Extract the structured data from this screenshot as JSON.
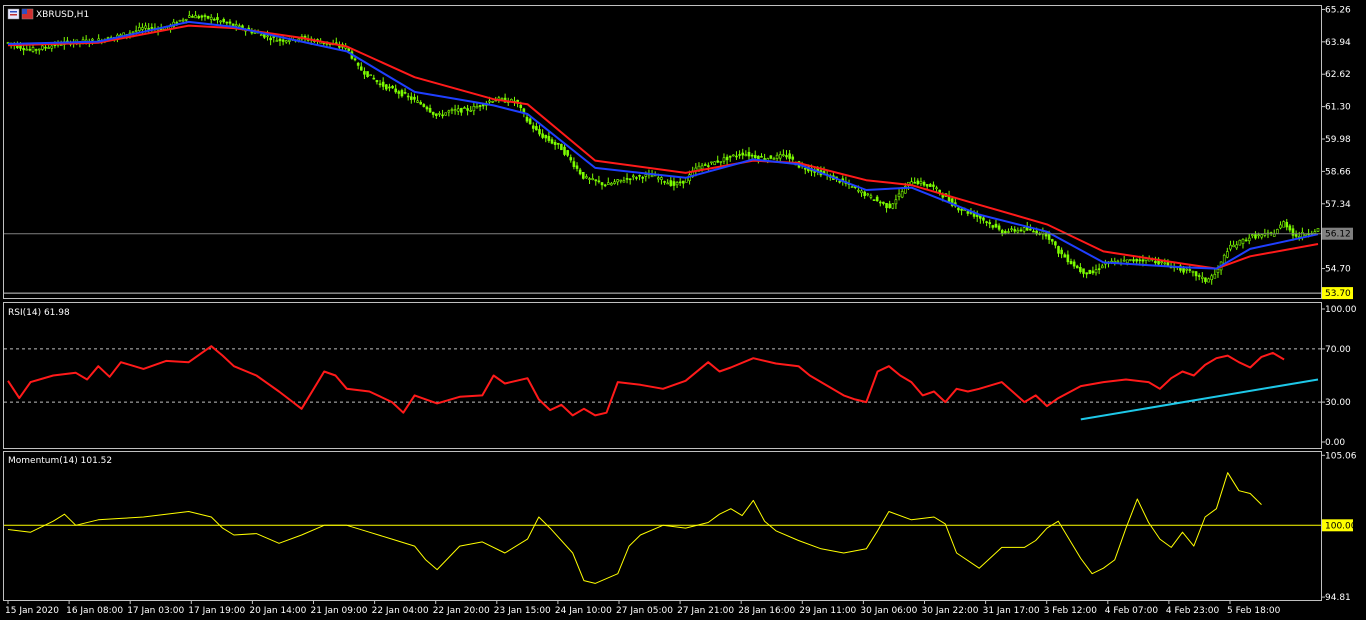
{
  "symbol_label": "XBRUSD,H1",
  "colors": {
    "background": "#000000",
    "frame": "#c0c0c0",
    "text": "#ffffff",
    "candle": "#7cfc00",
    "ma_fast": "#1f3fff",
    "ma_slow": "#ff1a1a",
    "rsi_line": "#ff1a1a",
    "trendline": "#1ec8e8",
    "momentum_line": "#ffff00",
    "level_hline": "#ffff00",
    "last_price_bg": "#808080",
    "low_price_bg": "#ffff00"
  },
  "chart_data": [
    {
      "type": "candlestick",
      "name": "price",
      "y_ticks": [
        "65.26",
        "63.94",
        "62.62",
        "61.30",
        "59.98",
        "58.66",
        "57.34",
        "56.12",
        "54.70"
      ],
      "ylim": [
        53.5,
        65.4
      ],
      "last_price": 56.12,
      "last_price_label": "56.12",
      "low_line": 53.7,
      "low_line_label": "53.70",
      "x_labels": [
        "15 Jan 2020",
        "16 Jan 08:00",
        "17 Jan 03:00",
        "17 Jan 19:00",
        "20 Jan 14:00",
        "21 Jan 09:00",
        "22 Jan 04:00",
        "22 Jan 20:00",
        "23 Jan 15:00",
        "24 Jan 10:00",
        "27 Jan 05:00",
        "27 Jan 21:00",
        "28 Jan 16:00",
        "29 Jan 11:00",
        "30 Jan 06:00",
        "30 Jan 22:00",
        "31 Jan 17:00",
        "3 Feb 12:00",
        "4 Feb 07:00",
        "4 Feb 23:00",
        "5 Feb 18:00"
      ],
      "close_path": [
        [
          0,
          63.9
        ],
        [
          2,
          63.6
        ],
        [
          5,
          63.9
        ],
        [
          8,
          64.0
        ],
        [
          10,
          64.2
        ],
        [
          12,
          64.5
        ],
        [
          14,
          64.5
        ],
        [
          16,
          65.0
        ],
        [
          18,
          64.9
        ],
        [
          20,
          64.6
        ],
        [
          22,
          64.3
        ],
        [
          24,
          64.0
        ],
        [
          26,
          64.1
        ],
        [
          28,
          63.9
        ],
        [
          30,
          63.7
        ],
        [
          31,
          62.9
        ],
        [
          33,
          62.2
        ],
        [
          35,
          61.8
        ],
        [
          37,
          61.3
        ],
        [
          38,
          60.9
        ],
        [
          39,
          61.1
        ],
        [
          41,
          61.2
        ],
        [
          43,
          61.6
        ],
        [
          45,
          61.5
        ],
        [
          46,
          60.7
        ],
        [
          47,
          60.2
        ],
        [
          49,
          59.6
        ],
        [
          51,
          58.4
        ],
        [
          53,
          58.1
        ],
        [
          55,
          58.4
        ],
        [
          57,
          58.5
        ],
        [
          59,
          58.1
        ],
        [
          60,
          58.3
        ],
        [
          61,
          58.8
        ],
        [
          63,
          59.1
        ],
        [
          65,
          59.4
        ],
        [
          67,
          59.2
        ],
        [
          69,
          59.3
        ],
        [
          70,
          58.9
        ],
        [
          72,
          58.6
        ],
        [
          74,
          58.2
        ],
        [
          76,
          57.7
        ],
        [
          78,
          57.2
        ],
        [
          80,
          58.3
        ],
        [
          82,
          58.0
        ],
        [
          84,
          57.2
        ],
        [
          86,
          56.8
        ],
        [
          88,
          56.2
        ],
        [
          90,
          56.3
        ],
        [
          92,
          56.1
        ],
        [
          93,
          55.4
        ],
        [
          95,
          54.6
        ],
        [
          96,
          54.5
        ],
        [
          97,
          54.9
        ],
        [
          99,
          55.0
        ],
        [
          101,
          55.1
        ],
        [
          103,
          54.8
        ],
        [
          105,
          54.5
        ],
        [
          106,
          54.2
        ],
        [
          107,
          54.5
        ],
        [
          108,
          55.5
        ],
        [
          110,
          56.0
        ],
        [
          112,
          56.1
        ],
        [
          113,
          56.6
        ],
        [
          114,
          56.0
        ],
        [
          116,
          56.3
        ]
      ],
      "series": [
        {
          "name": "",
          "kind": "ma_fast",
          "values": [
            [
              0,
              63.85
            ],
            [
              8,
              63.95
            ],
            [
              16,
              64.75
            ],
            [
              20,
              64.55
            ],
            [
              26,
              63.95
            ],
            [
              30,
              63.55
            ],
            [
              36,
              61.9
            ],
            [
              43,
              61.35
            ],
            [
              46,
              61.0
            ],
            [
              52,
              58.8
            ],
            [
              60,
              58.4
            ],
            [
              66,
              59.15
            ],
            [
              70,
              58.95
            ],
            [
              76,
              57.9
            ],
            [
              80,
              58.0
            ],
            [
              86,
              56.9
            ],
            [
              92,
              56.2
            ],
            [
              97,
              54.95
            ],
            [
              104,
              54.75
            ],
            [
              107,
              54.7
            ],
            [
              110,
              55.5
            ],
            [
              116,
              56.1
            ]
          ]
        },
        {
          "name": "",
          "kind": "ma_slow",
          "values": [
            [
              0,
              63.8
            ],
            [
              8,
              63.9
            ],
            [
              16,
              64.6
            ],
            [
              20,
              64.5
            ],
            [
              26,
              64.1
            ],
            [
              30,
              63.75
            ],
            [
              36,
              62.5
            ],
            [
              43,
              61.6
            ],
            [
              46,
              61.4
            ],
            [
              52,
              59.1
            ],
            [
              60,
              58.6
            ],
            [
              66,
              59.1
            ],
            [
              70,
              59.0
            ],
            [
              76,
              58.3
            ],
            [
              80,
              58.1
            ],
            [
              86,
              57.3
            ],
            [
              92,
              56.5
            ],
            [
              97,
              55.4
            ],
            [
              104,
              54.9
            ],
            [
              107,
              54.7
            ],
            [
              110,
              55.2
            ],
            [
              116,
              55.7
            ]
          ]
        }
      ]
    },
    {
      "type": "line",
      "name": "rsi",
      "label": "RSI(14) 61.98",
      "y_ticks": [
        "100.00",
        "70.00",
        "30.00",
        "0.00"
      ],
      "levels": [
        70,
        30
      ],
      "ylim": [
        0,
        100
      ],
      "values": [
        [
          0,
          46
        ],
        [
          1,
          33
        ],
        [
          2,
          45
        ],
        [
          4,
          50
        ],
        [
          6,
          52
        ],
        [
          7,
          47
        ],
        [
          8,
          57
        ],
        [
          9,
          49
        ],
        [
          10,
          60
        ],
        [
          12,
          55
        ],
        [
          14,
          61
        ],
        [
          16,
          60
        ],
        [
          17,
          66
        ],
        [
          18,
          72
        ],
        [
          19,
          65
        ],
        [
          20,
          57
        ],
        [
          22,
          50
        ],
        [
          24,
          38
        ],
        [
          26,
          25
        ],
        [
          28,
          53
        ],
        [
          29,
          50
        ],
        [
          30,
          40
        ],
        [
          32,
          38
        ],
        [
          34,
          30
        ],
        [
          35,
          22
        ],
        [
          36,
          35
        ],
        [
          38,
          29
        ],
        [
          40,
          34
        ],
        [
          42,
          35
        ],
        [
          43,
          50
        ],
        [
          44,
          44
        ],
        [
          46,
          48
        ],
        [
          47,
          32
        ],
        [
          48,
          24
        ],
        [
          49,
          28
        ],
        [
          50,
          20
        ],
        [
          51,
          25
        ],
        [
          52,
          20
        ],
        [
          53,
          22
        ],
        [
          54,
          45
        ],
        [
          56,
          43
        ],
        [
          58,
          40
        ],
        [
          60,
          46
        ],
        [
          62,
          60
        ],
        [
          63,
          53
        ],
        [
          64,
          56
        ],
        [
          66,
          63
        ],
        [
          68,
          59
        ],
        [
          70,
          57
        ],
        [
          71,
          50
        ],
        [
          72,
          45
        ],
        [
          74,
          35
        ],
        [
          75,
          32
        ],
        [
          76,
          30
        ],
        [
          77,
          53
        ],
        [
          78,
          57
        ],
        [
          79,
          50
        ],
        [
          80,
          45
        ],
        [
          81,
          35
        ],
        [
          82,
          38
        ],
        [
          83,
          30
        ],
        [
          84,
          40
        ],
        [
          85,
          38
        ],
        [
          86,
          40
        ],
        [
          88,
          45
        ],
        [
          90,
          30
        ],
        [
          91,
          35
        ],
        [
          92,
          27
        ],
        [
          93,
          33
        ],
        [
          95,
          42
        ],
        [
          97,
          45
        ],
        [
          99,
          47
        ],
        [
          101,
          45
        ],
        [
          102,
          40
        ],
        [
          103,
          48
        ],
        [
          104,
          53
        ],
        [
          105,
          50
        ],
        [
          106,
          58
        ],
        [
          107,
          63
        ],
        [
          108,
          65
        ],
        [
          109,
          60
        ],
        [
          110,
          56
        ],
        [
          111,
          64
        ],
        [
          112,
          67
        ],
        [
          113,
          62
        ]
      ],
      "trendline": [
        [
          95,
          17
        ],
        [
          116,
          47
        ]
      ]
    },
    {
      "type": "line",
      "name": "momentum",
      "label": "Momentum(14) 101.52",
      "y_ticks": [
        "105.06",
        "100.00",
        "94.81"
      ],
      "level": 100,
      "level_label": "100.00",
      "ylim": [
        94.6,
        105.3
      ],
      "values": [
        [
          0,
          99.7
        ],
        [
          2,
          99.5
        ],
        [
          4,
          100.3
        ],
        [
          5,
          100.8
        ],
        [
          6,
          100.0
        ],
        [
          8,
          100.4
        ],
        [
          10,
          100.5
        ],
        [
          12,
          100.6
        ],
        [
          14,
          100.8
        ],
        [
          16,
          101.0
        ],
        [
          18,
          100.6
        ],
        [
          19,
          99.8
        ],
        [
          20,
          99.3
        ],
        [
          22,
          99.4
        ],
        [
          24,
          98.7
        ],
        [
          26,
          99.3
        ],
        [
          28,
          100.0
        ],
        [
          30,
          100.0
        ],
        [
          32,
          99.5
        ],
        [
          34,
          99.0
        ],
        [
          36,
          98.5
        ],
        [
          37,
          97.5
        ],
        [
          38,
          96.8
        ],
        [
          40,
          98.5
        ],
        [
          42,
          98.8
        ],
        [
          44,
          98.0
        ],
        [
          46,
          99.0
        ],
        [
          47,
          100.6
        ],
        [
          48,
          99.8
        ],
        [
          50,
          98.0
        ],
        [
          51,
          96.0
        ],
        [
          52,
          95.8
        ],
        [
          54,
          96.5
        ],
        [
          55,
          98.5
        ],
        [
          56,
          99.3
        ],
        [
          58,
          100.0
        ],
        [
          60,
          99.8
        ],
        [
          62,
          100.2
        ],
        [
          63,
          100.8
        ],
        [
          64,
          101.2
        ],
        [
          65,
          100.7
        ],
        [
          66,
          101.8
        ],
        [
          67,
          100.3
        ],
        [
          68,
          99.6
        ],
        [
          70,
          98.9
        ],
        [
          72,
          98.3
        ],
        [
          74,
          98.0
        ],
        [
          76,
          98.3
        ],
        [
          77,
          99.6
        ],
        [
          78,
          101.0
        ],
        [
          80,
          100.4
        ],
        [
          82,
          100.6
        ],
        [
          83,
          100.1
        ],
        [
          84,
          98.0
        ],
        [
          86,
          96.9
        ],
        [
          88,
          98.4
        ],
        [
          90,
          98.4
        ],
        [
          91,
          98.9
        ],
        [
          92,
          99.8
        ],
        [
          93,
          100.3
        ],
        [
          95,
          97.6
        ],
        [
          96,
          96.5
        ],
        [
          97,
          96.9
        ],
        [
          98,
          97.5
        ],
        [
          99,
          99.8
        ],
        [
          100,
          101.9
        ],
        [
          101,
          100.2
        ],
        [
          102,
          99.0
        ],
        [
          103,
          98.4
        ],
        [
          104,
          99.5
        ],
        [
          105,
          98.5
        ],
        [
          106,
          100.6
        ],
        [
          107,
          101.2
        ],
        [
          108,
          103.8
        ],
        [
          109,
          102.5
        ],
        [
          110,
          102.3
        ],
        [
          111,
          101.5
        ]
      ]
    }
  ]
}
